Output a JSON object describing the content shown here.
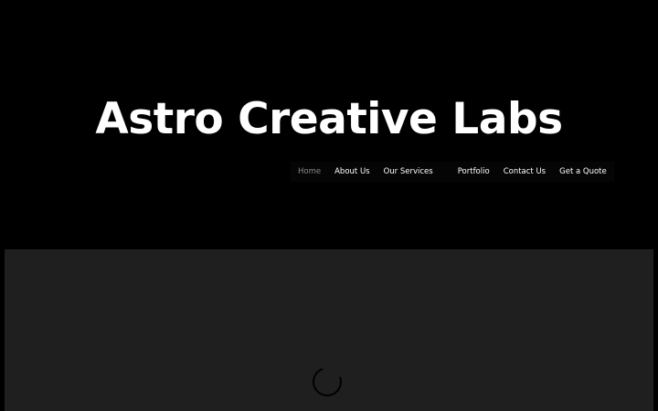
{
  "header": {
    "site_title": "Astro Creative Labs"
  },
  "nav": {
    "items": [
      {
        "label": "Home",
        "active": true
      },
      {
        "label": "About Us",
        "active": false
      },
      {
        "label": "Our Services",
        "active": false
      },
      {
        "label": "Portfolio",
        "active": false
      },
      {
        "label": "Contact Us",
        "active": false
      },
      {
        "label": "Get a Quote",
        "active": false
      }
    ]
  },
  "colors": {
    "background": "#000000",
    "panel": "#1f1f1f",
    "text": "#ffffff",
    "nav_active": "#8a8a8a"
  },
  "icons": {
    "loader": "loading-spinner-icon"
  }
}
